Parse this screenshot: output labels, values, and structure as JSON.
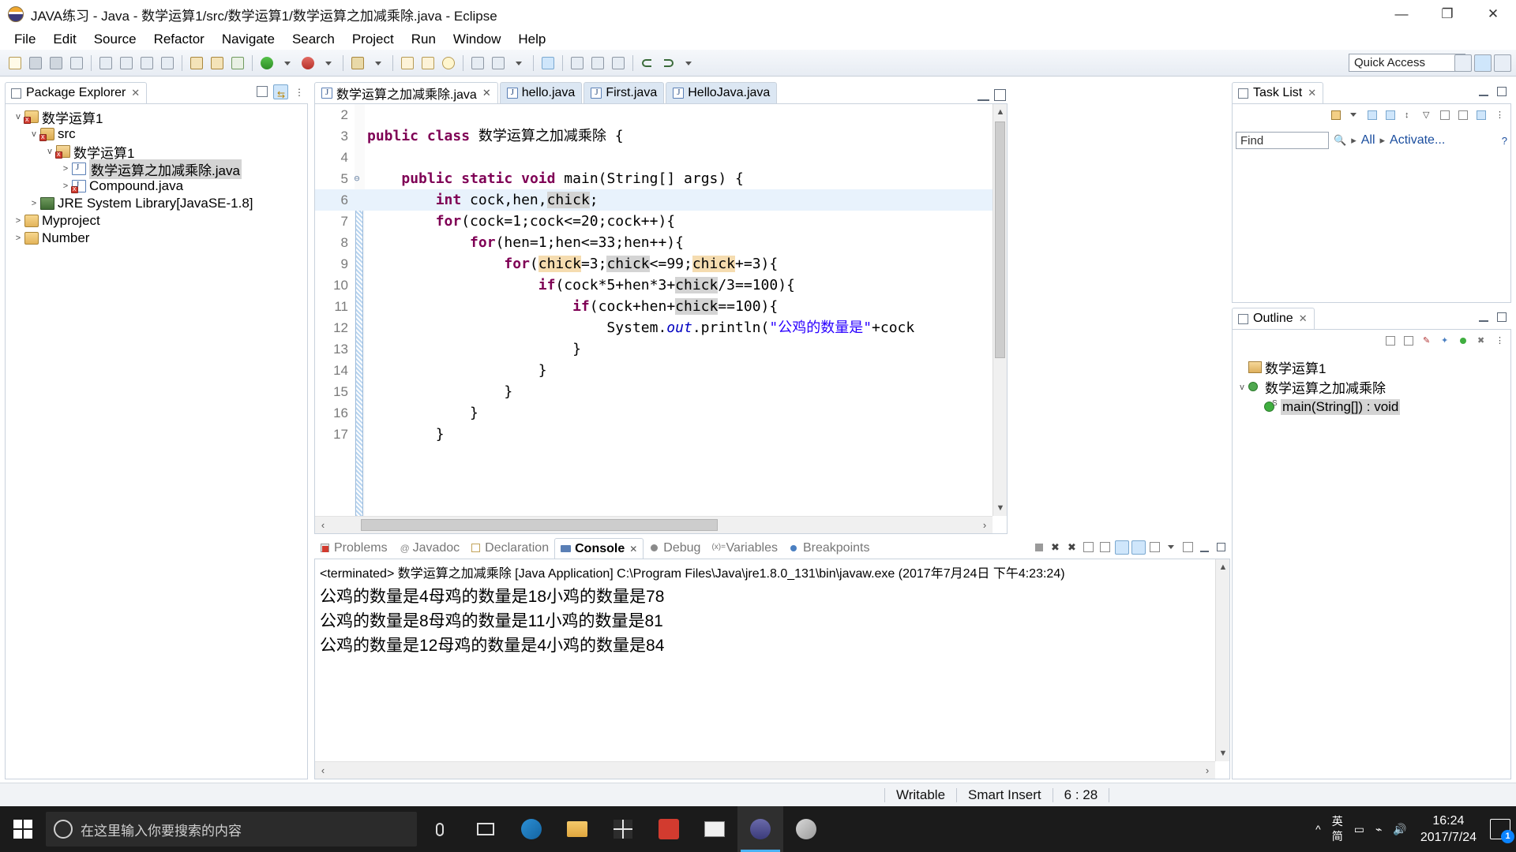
{
  "window": {
    "title": "JAVA练习 - Java - 数学运算1/src/数学运算1/数学运算之加减乘除.java - Eclipse",
    "app_icon": "eclipse-icon",
    "minimize": "—",
    "maximize": "❐",
    "close": "✕"
  },
  "menu": {
    "items": [
      {
        "label": "File"
      },
      {
        "label": "Edit"
      },
      {
        "label": "Source"
      },
      {
        "label": "Refactor"
      },
      {
        "label": "Navigate"
      },
      {
        "label": "Search"
      },
      {
        "label": "Project"
      },
      {
        "label": "Run"
      },
      {
        "label": "Window"
      },
      {
        "label": "Help"
      }
    ]
  },
  "toolbar": {
    "quick_access_placeholder": "Quick Access"
  },
  "package_explorer": {
    "title": "Package Explorer",
    "close_glyph": "✕",
    "tree": [
      {
        "label": "数学运算1",
        "icon": "java-project-icon",
        "arrow": "v",
        "indent": 0,
        "selected": false,
        "error": true
      },
      {
        "label": "src",
        "icon": "source-folder-icon",
        "arrow": "v",
        "indent": 1,
        "selected": false,
        "error": true
      },
      {
        "label": "数学运算1",
        "icon": "package-icon",
        "arrow": "v",
        "indent": 2,
        "selected": false,
        "error": true
      },
      {
        "label": "数学运算之加减乘除.java",
        "icon": "java-file-icon",
        "arrow": ">",
        "indent": 3,
        "selected": true,
        "error": false
      },
      {
        "label": "Compound.java",
        "icon": "java-file-icon",
        "arrow": ">",
        "indent": 3,
        "selected": false,
        "error": true
      },
      {
        "label": "JRE System Library",
        "suffix": " [JavaSE-1.8]",
        "icon": "library-icon",
        "arrow": ">",
        "indent": 1,
        "selected": false,
        "error": false
      },
      {
        "label": "Myproject",
        "icon": "java-project-icon",
        "arrow": ">",
        "indent": 0,
        "selected": false,
        "error": false
      },
      {
        "label": "Number",
        "icon": "java-project-icon",
        "arrow": ">",
        "indent": 0,
        "selected": false,
        "error": false
      }
    ]
  },
  "editor": {
    "tabs": [
      {
        "label": "数学运算之加减乘除.java",
        "active": true,
        "closeable": true
      },
      {
        "label": "hello.java",
        "active": false,
        "closeable": false
      },
      {
        "label": "First.java",
        "active": false,
        "closeable": false
      },
      {
        "label": "HelloJava.java",
        "active": false,
        "closeable": false
      }
    ],
    "close_glyph": "✕",
    "lines": [
      {
        "num": "2",
        "fold": "",
        "current": false,
        "tokens": []
      },
      {
        "num": "3",
        "fold": "",
        "current": false,
        "tokens": [
          {
            "t": "public",
            "c": "kw"
          },
          {
            "t": " ",
            "c": "id"
          },
          {
            "t": "class",
            "c": "kw"
          },
          {
            "t": " 数学运算之加减乘除 {",
            "c": "id"
          }
        ]
      },
      {
        "num": "4",
        "fold": "",
        "current": false,
        "tokens": []
      },
      {
        "num": "5",
        "fold": "⊖",
        "current": false,
        "tokens": [
          {
            "t": "    ",
            "c": "id"
          },
          {
            "t": "public",
            "c": "kw"
          },
          {
            "t": " ",
            "c": "id"
          },
          {
            "t": "static",
            "c": "kw"
          },
          {
            "t": " ",
            "c": "id"
          },
          {
            "t": "void",
            "c": "kw"
          },
          {
            "t": " main(String[] args) {",
            "c": "id"
          }
        ]
      },
      {
        "num": "6",
        "fold": "",
        "current": true,
        "tokens": [
          {
            "t": "        ",
            "c": "id"
          },
          {
            "t": "int",
            "c": "kw"
          },
          {
            "t": " cock,hen,",
            "c": "id"
          },
          {
            "t": "chick",
            "c": "id",
            "hl": "read"
          },
          {
            "t": ";",
            "c": "id"
          }
        ]
      },
      {
        "num": "7",
        "fold": "",
        "current": false,
        "tokens": [
          {
            "t": "        ",
            "c": "id"
          },
          {
            "t": "for",
            "c": "kw"
          },
          {
            "t": "(cock=1;cock<=20;cock++){",
            "c": "id"
          }
        ]
      },
      {
        "num": "8",
        "fold": "",
        "current": false,
        "tokens": [
          {
            "t": "            ",
            "c": "id"
          },
          {
            "t": "for",
            "c": "kw"
          },
          {
            "t": "(hen=1;hen<=33;hen++){",
            "c": "id"
          }
        ]
      },
      {
        "num": "9",
        "fold": "",
        "current": false,
        "tokens": [
          {
            "t": "                ",
            "c": "id"
          },
          {
            "t": "for",
            "c": "kw"
          },
          {
            "t": "(",
            "c": "id"
          },
          {
            "t": "chick",
            "c": "id",
            "hl": "write"
          },
          {
            "t": "=3;",
            "c": "id"
          },
          {
            "t": "chick",
            "c": "id",
            "hl": "read"
          },
          {
            "t": "<=99;",
            "c": "id"
          },
          {
            "t": "chick",
            "c": "id",
            "hl": "write"
          },
          {
            "t": "+=3){",
            "c": "id"
          }
        ]
      },
      {
        "num": "10",
        "fold": "",
        "current": false,
        "tokens": [
          {
            "t": "                    ",
            "c": "id"
          },
          {
            "t": "if",
            "c": "kw"
          },
          {
            "t": "(cock*5+hen*3+",
            "c": "id"
          },
          {
            "t": "chick",
            "c": "id",
            "hl": "read"
          },
          {
            "t": "/3==100){",
            "c": "id"
          }
        ]
      },
      {
        "num": "11",
        "fold": "",
        "current": false,
        "tokens": [
          {
            "t": "                        ",
            "c": "id"
          },
          {
            "t": "if",
            "c": "kw"
          },
          {
            "t": "(cock+hen+",
            "c": "id"
          },
          {
            "t": "chick",
            "c": "id",
            "hl": "read"
          },
          {
            "t": "==100){",
            "c": "id"
          }
        ]
      },
      {
        "num": "12",
        "fold": "",
        "current": false,
        "tokens": [
          {
            "t": "                            System.",
            "c": "id"
          },
          {
            "t": "out",
            "c": "fld"
          },
          {
            "t": ".println(",
            "c": "id"
          },
          {
            "t": "\"公鸡的数量是\"",
            "c": "str"
          },
          {
            "t": "+cock",
            "c": "id"
          }
        ]
      },
      {
        "num": "13",
        "fold": "",
        "current": false,
        "tokens": [
          {
            "t": "                        }",
            "c": "id"
          }
        ]
      },
      {
        "num": "14",
        "fold": "",
        "current": false,
        "tokens": [
          {
            "t": "                    }",
            "c": "id"
          }
        ]
      },
      {
        "num": "15",
        "fold": "",
        "current": false,
        "tokens": [
          {
            "t": "                }",
            "c": "id"
          }
        ]
      },
      {
        "num": "16",
        "fold": "",
        "current": false,
        "tokens": [
          {
            "t": "            }",
            "c": "id"
          }
        ]
      },
      {
        "num": "17",
        "fold": "",
        "current": false,
        "tokens": [
          {
            "t": "        }",
            "c": "id"
          }
        ]
      }
    ]
  },
  "console": {
    "tabs": [
      {
        "label": "Problems",
        "icon": "problems-icon",
        "active": false
      },
      {
        "label": "Javadoc",
        "icon": "javadoc-icon",
        "active": false
      },
      {
        "label": "Declaration",
        "icon": "declaration-icon",
        "active": false
      },
      {
        "label": "Console",
        "icon": "console-icon",
        "active": true
      },
      {
        "label": "Debug",
        "icon": "debug-icon",
        "active": false
      },
      {
        "label": "Variables",
        "icon": "variables-icon",
        "active": false
      },
      {
        "label": "Breakpoints",
        "icon": "breakpoints-icon",
        "active": false
      }
    ],
    "close_glyph": "✕",
    "process_line": "<terminated> 数学运算之加减乘除 [Java Application] C:\\Program Files\\Java\\jre1.8.0_131\\bin\\javaw.exe (2017年7月24日 下午4:23:24)",
    "output": [
      "公鸡的数量是4母鸡的数量是18小鸡的数量是78",
      "公鸡的数量是8母鸡的数量是11小鸡的数量是81",
      "公鸡的数量是12母鸡的数量是4小鸡的数量是84"
    ]
  },
  "task_list": {
    "title": "Task List",
    "close_glyph": "✕",
    "find_placeholder": "Find",
    "all_label": "All",
    "activate_label": "Activate...",
    "help_glyph": "?"
  },
  "outline": {
    "title": "Outline",
    "close_glyph": "✕",
    "items": [
      {
        "label": "数学运算1",
        "icon": "package-declaration-icon",
        "arrow": "",
        "indent": 0,
        "selected": false
      },
      {
        "label": "数学运算之加减乘除",
        "icon": "class-icon",
        "arrow": "v",
        "indent": 0,
        "selected": false
      },
      {
        "label": "main(String[]) : void",
        "icon": "method-icon",
        "arrow": "",
        "indent": 1,
        "selected": true
      }
    ]
  },
  "statusbar": {
    "writable": "Writable",
    "insert_mode": "Smart Insert",
    "cursor_position": "6 : 28"
  },
  "taskbar": {
    "search_placeholder": "在这里输入你要搜索的内容",
    "apps": [
      {
        "name": "cortana-icon"
      },
      {
        "name": "microphone-icon"
      },
      {
        "name": "task-view-icon"
      },
      {
        "name": "edge-icon"
      },
      {
        "name": "file-explorer-icon"
      },
      {
        "name": "store-icon"
      },
      {
        "name": "news-icon"
      },
      {
        "name": "mail-icon"
      },
      {
        "name": "eclipse-icon"
      },
      {
        "name": "browser-icon"
      }
    ],
    "ime_lang": "英",
    "ime_mode": "简",
    "clock_time": "16:24",
    "clock_date": "2017/7/24",
    "notification_count": "1"
  }
}
